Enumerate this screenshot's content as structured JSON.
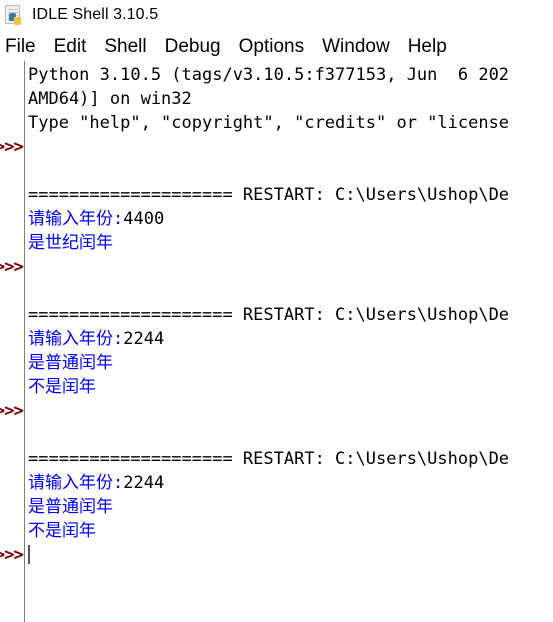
{
  "window": {
    "title": "IDLE Shell 3.10.5",
    "icon": "python-idle-icon"
  },
  "menubar": {
    "items": [
      {
        "label": "File"
      },
      {
        "label": "Edit"
      },
      {
        "label": "Shell"
      },
      {
        "label": "Debug"
      },
      {
        "label": "Options"
      },
      {
        "label": "Window"
      },
      {
        "label": "Help"
      }
    ]
  },
  "colors": {
    "prompt": "#770000",
    "stdout": "#0000ff",
    "stdin": "#000000",
    "keyword": "#bb6600",
    "string": "#007700",
    "background": "#ffffff"
  },
  "shell": {
    "prompt_text": ">>>",
    "lines": [
      {
        "prompt": "",
        "segments": [
          {
            "text": "Python 3.10.5 (tags/v3.10.5:f377153, Jun  6 202",
            "color": "black"
          }
        ]
      },
      {
        "prompt": "",
        "segments": [
          {
            "text": "AMD64)] on win32",
            "color": "black"
          }
        ]
      },
      {
        "prompt": "",
        "segments": [
          {
            "text": "Type \"help\", \"copyright\", \"credits\" or \"license",
            "color": "black"
          }
        ]
      },
      {
        "prompt": ">>>",
        "segments": []
      },
      {
        "prompt": "",
        "segments": []
      },
      {
        "prompt": "",
        "segments": [
          {
            "text": "==================== RESTART: C:\\Users\\Ushop\\De",
            "color": "black"
          }
        ]
      },
      {
        "prompt": "",
        "segments": [
          {
            "text": "请输入年份:",
            "color": "blue"
          },
          {
            "text": "4400",
            "color": "black"
          }
        ]
      },
      {
        "prompt": "",
        "segments": [
          {
            "text": "是世纪闰年",
            "color": "blue"
          }
        ]
      },
      {
        "prompt": ">>>",
        "segments": []
      },
      {
        "prompt": "",
        "segments": []
      },
      {
        "prompt": "",
        "segments": [
          {
            "text": "==================== RESTART: C:\\Users\\Ushop\\De",
            "color": "black"
          }
        ]
      },
      {
        "prompt": "",
        "segments": [
          {
            "text": "请输入年份:",
            "color": "blue"
          },
          {
            "text": "2244",
            "color": "black"
          }
        ]
      },
      {
        "prompt": "",
        "segments": [
          {
            "text": "是普通闰年",
            "color": "blue"
          }
        ]
      },
      {
        "prompt": "",
        "segments": [
          {
            "text": "不是闰年",
            "color": "blue"
          }
        ]
      },
      {
        "prompt": ">>>",
        "segments": []
      },
      {
        "prompt": "",
        "segments": []
      },
      {
        "prompt": "",
        "segments": [
          {
            "text": "==================== RESTART: C:\\Users\\Ushop\\De",
            "color": "black"
          }
        ]
      },
      {
        "prompt": "",
        "segments": [
          {
            "text": "请输入年份:",
            "color": "blue"
          },
          {
            "text": "2244",
            "color": "black"
          }
        ]
      },
      {
        "prompt": "",
        "segments": [
          {
            "text": "是普通闰年",
            "color": "blue"
          }
        ]
      },
      {
        "prompt": "",
        "segments": [
          {
            "text": "不是闰年",
            "color": "blue"
          }
        ]
      },
      {
        "prompt": ">>>",
        "segments": [],
        "caret": true
      }
    ]
  }
}
